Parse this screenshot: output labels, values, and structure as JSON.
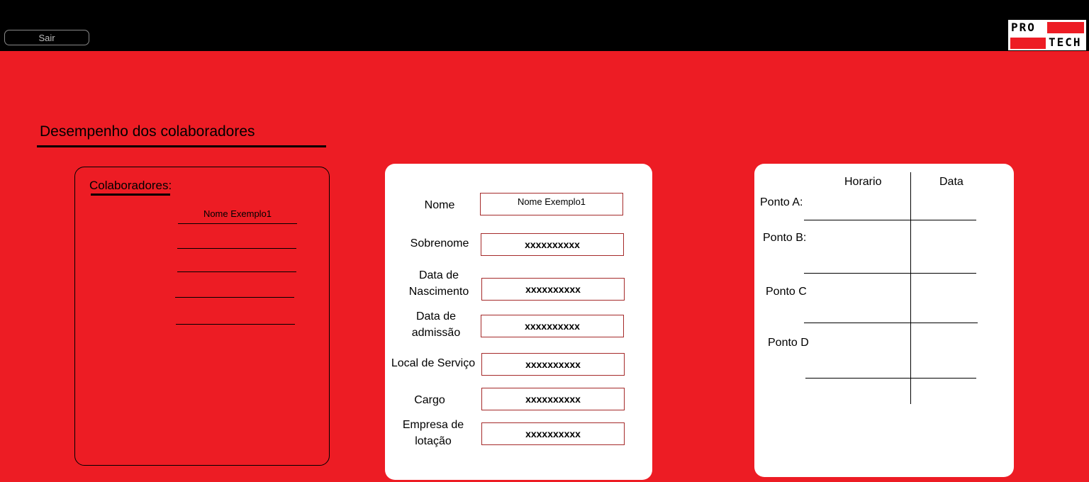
{
  "header": {
    "exit_label": "Sair",
    "logo": {
      "line1": "PRO",
      "line2": "TECH"
    }
  },
  "page": {
    "title": "Desempenho dos colaboradores"
  },
  "collaborators": {
    "label": "Colaboradores:",
    "items": [
      "Nome Exemplo1",
      "",
      "",
      "",
      ""
    ]
  },
  "form": {
    "fields": [
      {
        "label": "Nome",
        "value": "Nome Exemplo1"
      },
      {
        "label": "Sobrenome",
        "value": "xxxxxxxxxx"
      },
      {
        "label": "Data de Nascimento",
        "value": "xxxxxxxxxx"
      },
      {
        "label": "Data de admissão",
        "value": "xxxxxxxxxx"
      },
      {
        "label": "Local de Serviço",
        "value": "xxxxxxxxxx"
      },
      {
        "label": "Cargo",
        "value": "xxxxxxxxxx"
      },
      {
        "label": "Empresa de lotação",
        "value": "xxxxxxxxxx"
      }
    ]
  },
  "points": {
    "headers": {
      "horario": "Horario",
      "data": "Data"
    },
    "rows": [
      "Ponto A:",
      "Ponto B:",
      "Ponto C",
      "Ponto D"
    ]
  },
  "colors": {
    "background": "#ed1c24",
    "topbar": "#000000",
    "panel": "#ffffff"
  }
}
